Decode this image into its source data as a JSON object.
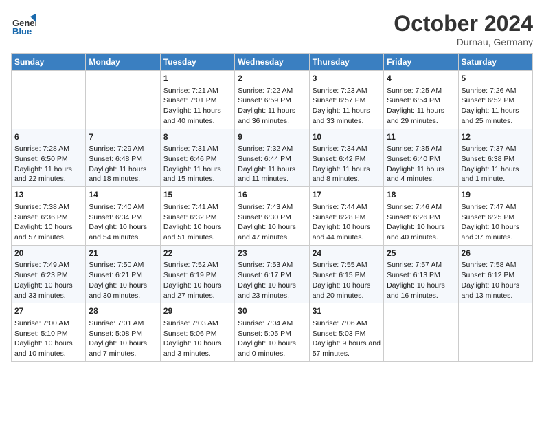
{
  "header": {
    "logo_general": "General",
    "logo_blue": "Blue",
    "month_year": "October 2024",
    "location": "Durnau, Germany"
  },
  "columns": [
    "Sunday",
    "Monday",
    "Tuesday",
    "Wednesday",
    "Thursday",
    "Friday",
    "Saturday"
  ],
  "weeks": [
    [
      {
        "day": "",
        "info": ""
      },
      {
        "day": "",
        "info": ""
      },
      {
        "day": "1",
        "info": "Sunrise: 7:21 AM\nSunset: 7:01 PM\nDaylight: 11 hours and 40 minutes."
      },
      {
        "day": "2",
        "info": "Sunrise: 7:22 AM\nSunset: 6:59 PM\nDaylight: 11 hours and 36 minutes."
      },
      {
        "day": "3",
        "info": "Sunrise: 7:23 AM\nSunset: 6:57 PM\nDaylight: 11 hours and 33 minutes."
      },
      {
        "day": "4",
        "info": "Sunrise: 7:25 AM\nSunset: 6:54 PM\nDaylight: 11 hours and 29 minutes."
      },
      {
        "day": "5",
        "info": "Sunrise: 7:26 AM\nSunset: 6:52 PM\nDaylight: 11 hours and 25 minutes."
      }
    ],
    [
      {
        "day": "6",
        "info": "Sunrise: 7:28 AM\nSunset: 6:50 PM\nDaylight: 11 hours and 22 minutes."
      },
      {
        "day": "7",
        "info": "Sunrise: 7:29 AM\nSunset: 6:48 PM\nDaylight: 11 hours and 18 minutes."
      },
      {
        "day": "8",
        "info": "Sunrise: 7:31 AM\nSunset: 6:46 PM\nDaylight: 11 hours and 15 minutes."
      },
      {
        "day": "9",
        "info": "Sunrise: 7:32 AM\nSunset: 6:44 PM\nDaylight: 11 hours and 11 minutes."
      },
      {
        "day": "10",
        "info": "Sunrise: 7:34 AM\nSunset: 6:42 PM\nDaylight: 11 hours and 8 minutes."
      },
      {
        "day": "11",
        "info": "Sunrise: 7:35 AM\nSunset: 6:40 PM\nDaylight: 11 hours and 4 minutes."
      },
      {
        "day": "12",
        "info": "Sunrise: 7:37 AM\nSunset: 6:38 PM\nDaylight: 11 hours and 1 minute."
      }
    ],
    [
      {
        "day": "13",
        "info": "Sunrise: 7:38 AM\nSunset: 6:36 PM\nDaylight: 10 hours and 57 minutes."
      },
      {
        "day": "14",
        "info": "Sunrise: 7:40 AM\nSunset: 6:34 PM\nDaylight: 10 hours and 54 minutes."
      },
      {
        "day": "15",
        "info": "Sunrise: 7:41 AM\nSunset: 6:32 PM\nDaylight: 10 hours and 51 minutes."
      },
      {
        "day": "16",
        "info": "Sunrise: 7:43 AM\nSunset: 6:30 PM\nDaylight: 10 hours and 47 minutes."
      },
      {
        "day": "17",
        "info": "Sunrise: 7:44 AM\nSunset: 6:28 PM\nDaylight: 10 hours and 44 minutes."
      },
      {
        "day": "18",
        "info": "Sunrise: 7:46 AM\nSunset: 6:26 PM\nDaylight: 10 hours and 40 minutes."
      },
      {
        "day": "19",
        "info": "Sunrise: 7:47 AM\nSunset: 6:25 PM\nDaylight: 10 hours and 37 minutes."
      }
    ],
    [
      {
        "day": "20",
        "info": "Sunrise: 7:49 AM\nSunset: 6:23 PM\nDaylight: 10 hours and 33 minutes."
      },
      {
        "day": "21",
        "info": "Sunrise: 7:50 AM\nSunset: 6:21 PM\nDaylight: 10 hours and 30 minutes."
      },
      {
        "day": "22",
        "info": "Sunrise: 7:52 AM\nSunset: 6:19 PM\nDaylight: 10 hours and 27 minutes."
      },
      {
        "day": "23",
        "info": "Sunrise: 7:53 AM\nSunset: 6:17 PM\nDaylight: 10 hours and 23 minutes."
      },
      {
        "day": "24",
        "info": "Sunrise: 7:55 AM\nSunset: 6:15 PM\nDaylight: 10 hours and 20 minutes."
      },
      {
        "day": "25",
        "info": "Sunrise: 7:57 AM\nSunset: 6:13 PM\nDaylight: 10 hours and 16 minutes."
      },
      {
        "day": "26",
        "info": "Sunrise: 7:58 AM\nSunset: 6:12 PM\nDaylight: 10 hours and 13 minutes."
      }
    ],
    [
      {
        "day": "27",
        "info": "Sunrise: 7:00 AM\nSunset: 5:10 PM\nDaylight: 10 hours and 10 minutes."
      },
      {
        "day": "28",
        "info": "Sunrise: 7:01 AM\nSunset: 5:08 PM\nDaylight: 10 hours and 7 minutes."
      },
      {
        "day": "29",
        "info": "Sunrise: 7:03 AM\nSunset: 5:06 PM\nDaylight: 10 hours and 3 minutes."
      },
      {
        "day": "30",
        "info": "Sunrise: 7:04 AM\nSunset: 5:05 PM\nDaylight: 10 hours and 0 minutes."
      },
      {
        "day": "31",
        "info": "Sunrise: 7:06 AM\nSunset: 5:03 PM\nDaylight: 9 hours and 57 minutes."
      },
      {
        "day": "",
        "info": ""
      },
      {
        "day": "",
        "info": ""
      }
    ]
  ]
}
